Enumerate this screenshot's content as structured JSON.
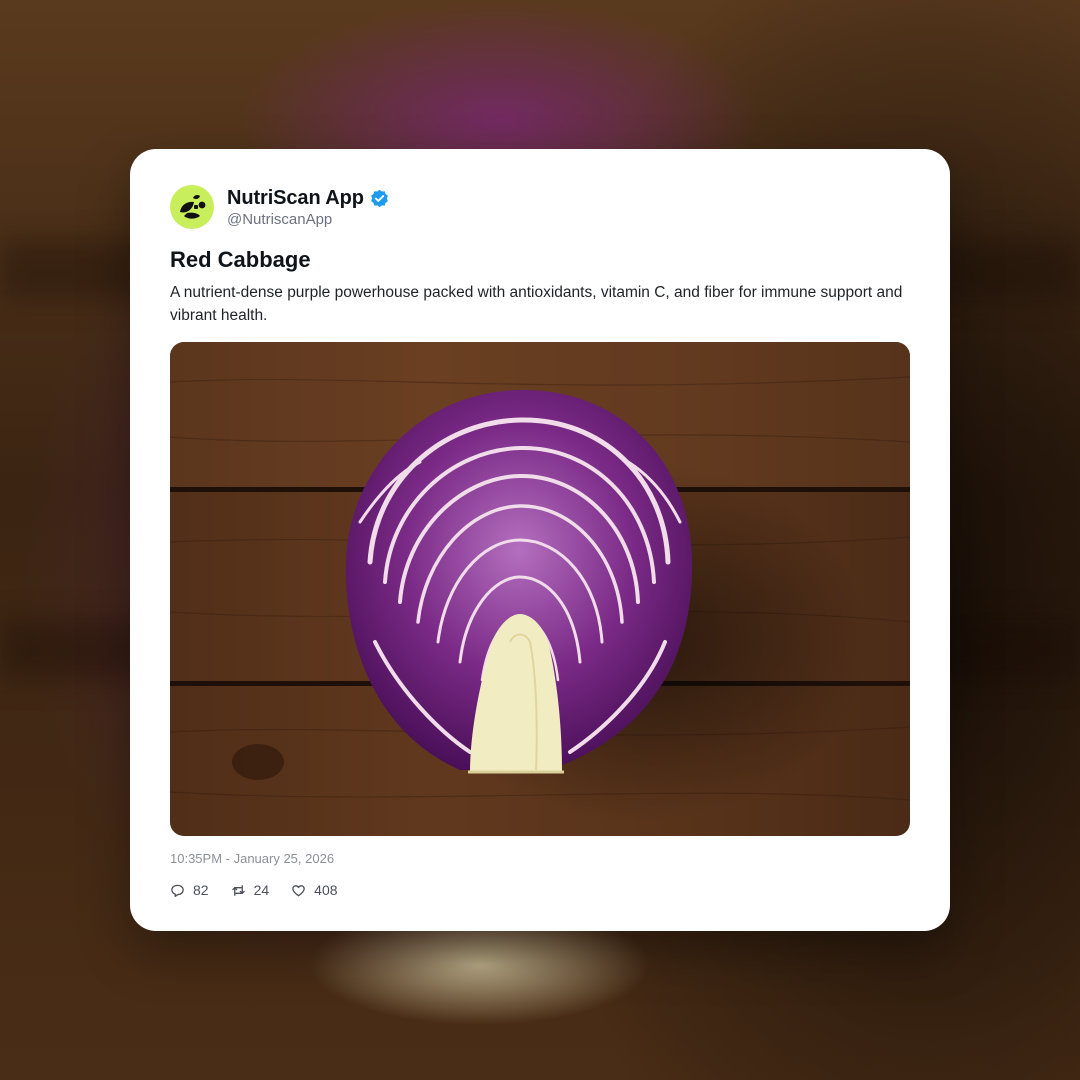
{
  "post": {
    "author": {
      "display_name": "NutriScan App",
      "handle": "@NutriscanApp",
      "verified": true,
      "avatar_icon": "leaf-logo-icon",
      "avatar_color": "#c9ee5c",
      "verified_color": "#1d9bf0"
    },
    "title": "Red Cabbage",
    "description": "A nutrient-dense purple powerhouse packed with antioxidants, vitamin C, and fiber for immune support and vibrant health.",
    "media": {
      "subject": "red-cabbage-half-on-wooden-table"
    },
    "timestamp": "10:35PM - January 25, 2026",
    "actions": {
      "replies": "82",
      "reposts": "24",
      "likes": "408"
    }
  }
}
